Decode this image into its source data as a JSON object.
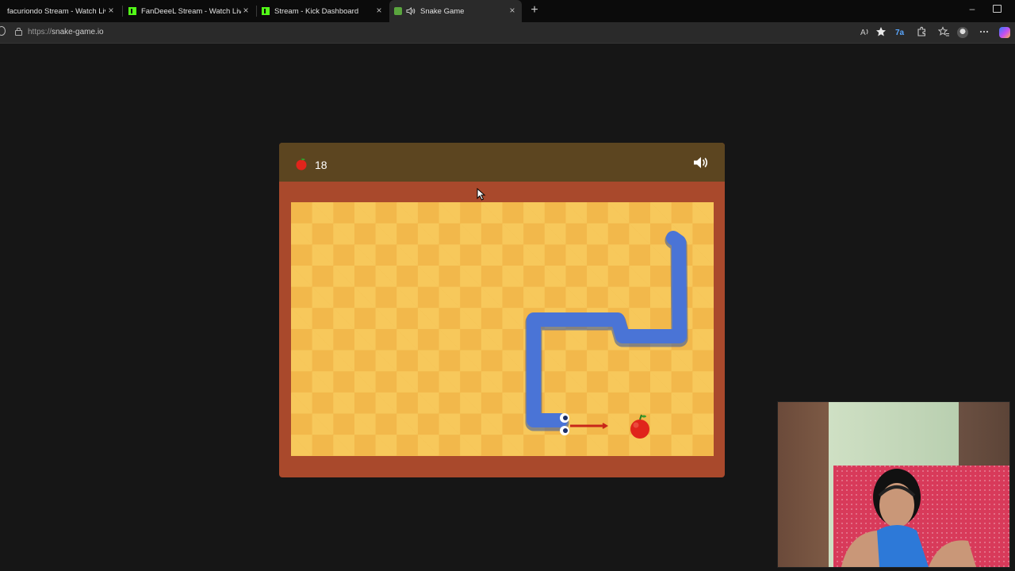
{
  "browser": {
    "tabs": [
      {
        "title": "facuriondo Stream - Watch Live o",
        "favicon": "kick-icon"
      },
      {
        "title": "FanDeeeL Stream - Watch Live on",
        "favicon": "kick-icon"
      },
      {
        "title": "Stream - Kick Dashboard",
        "favicon": "kick-icon"
      },
      {
        "title": "Snake Game",
        "favicon": "snake-game-icon",
        "active": true,
        "audio": true
      }
    ],
    "new_tab_symbol": "+",
    "close_symbol": "×",
    "address": {
      "url_protocol": "https://",
      "url_host": "snake-game.io"
    },
    "toolbar_icons": [
      "read-aloud-icon",
      "favorite-star-icon",
      "translate-icon",
      "extensions-icon",
      "favorites-icon",
      "profile-icon",
      "more-icon",
      "copilot-icon"
    ],
    "window_controls": {
      "minimize": "–"
    }
  },
  "game": {
    "score": "18",
    "colors": {
      "header": "#5c4520",
      "frame": "#a9492c",
      "board_light": "#f7c85b",
      "board_dark": "#f2b84b",
      "snake": "#4a74d6",
      "apple": "#e0241b"
    },
    "sound": "on"
  }
}
